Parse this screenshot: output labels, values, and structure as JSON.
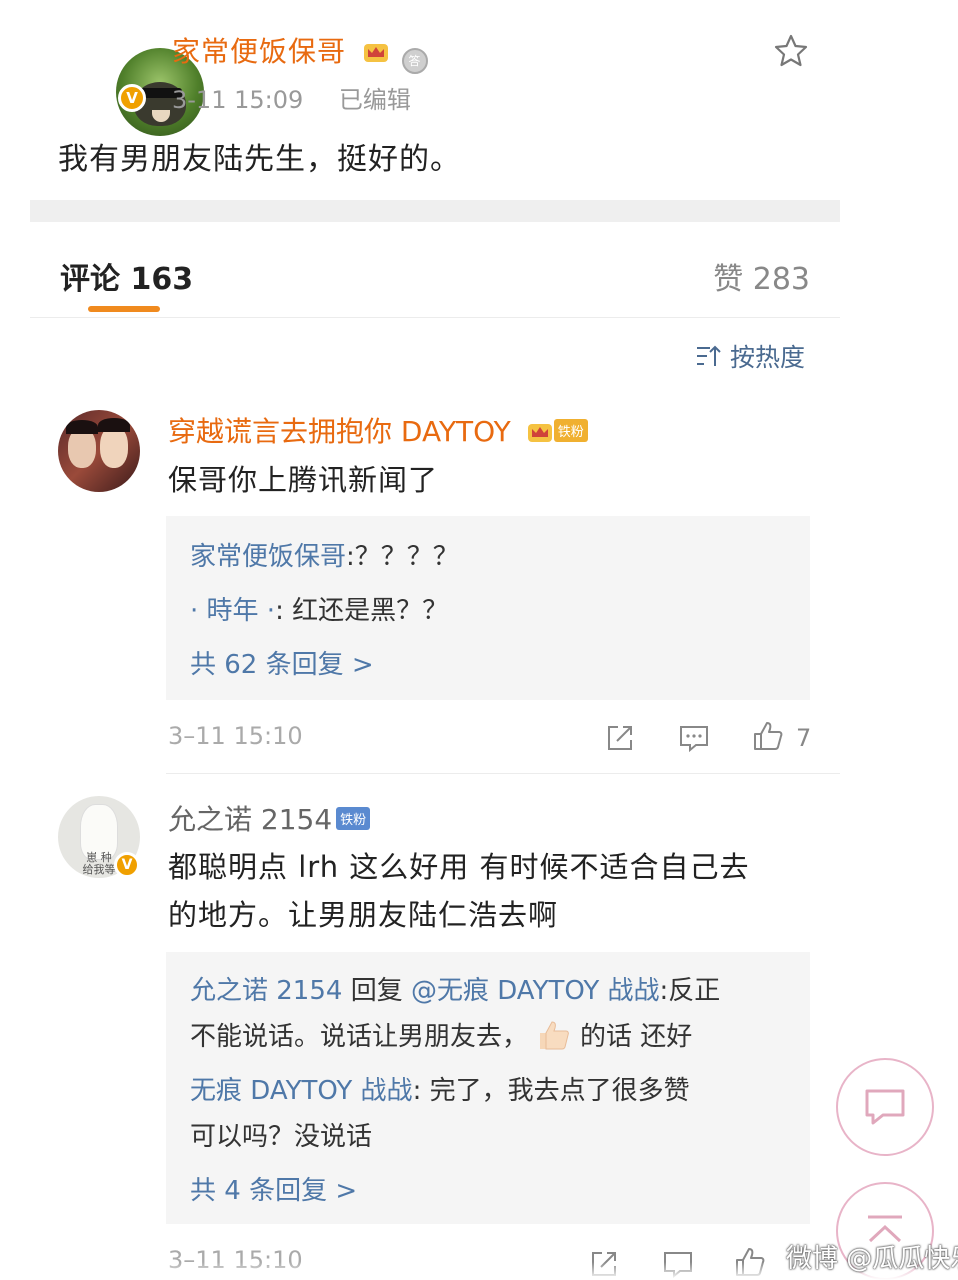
{
  "post": {
    "author": "家常便饭保哥",
    "time": "3-11 15:09",
    "edited": "已编辑",
    "text": "我有男朋友陆先生，挺好的。",
    "verified_mark": "V",
    "medal_text": "答"
  },
  "tabs": {
    "comments_label": "评论 163",
    "likes_label": "赞 283"
  },
  "sort": {
    "label": "按热度"
  },
  "comments": [
    {
      "author": "穿越谎言去拥抱你 DAYTOY",
      "badge": "铁粉",
      "text": "保哥你上腾讯新闻了",
      "replies": [
        {
          "who": "家常便饭保哥",
          "text": ":？？？？"
        },
        {
          "who": "· 時年 ·",
          "text": ": 红还是黑？？"
        }
      ],
      "more": "共 62 条回复 >",
      "time": "3–11 15:10",
      "likes": "7"
    },
    {
      "author": "允之诺 2154",
      "badge": "铁粉",
      "text_line1": "都聪明点 lrh 这么好用 有时候不适合自己去",
      "text_line2": "的地方。让男朋友陆仁浩去啊",
      "avatar_caption": "崽 种\n给我等",
      "verified_mark": "V",
      "replies": [
        {
          "who": "允之诺 2154",
          "mid": " 回复 ",
          "mention": "@无痕 DAYTOY 战战",
          "text": ":反正",
          "line2a": "不能说话。说话让男朋友去，",
          "line2b": "的话 还好"
        },
        {
          "who": "无痕 DAYTOY 战战",
          "text": ": 完了，我去点了很多赞",
          "line2": "可以吗？没说话"
        }
      ],
      "more": "共 4 条回复 >",
      "time": "3–11 15:10"
    }
  ],
  "watermark": "微博 @瓜瓜快乐",
  "colors": {
    "accent_orange": "#e86a10",
    "link_blue": "#4f78a8",
    "tab_underline": "#f08a1e"
  },
  "icons": [
    "star-icon",
    "sort-icon",
    "share-icon",
    "comment-icon",
    "like-icon",
    "chat-bubble-icon",
    "arrow-up-icon",
    "crown-icon",
    "medal-icon"
  ]
}
